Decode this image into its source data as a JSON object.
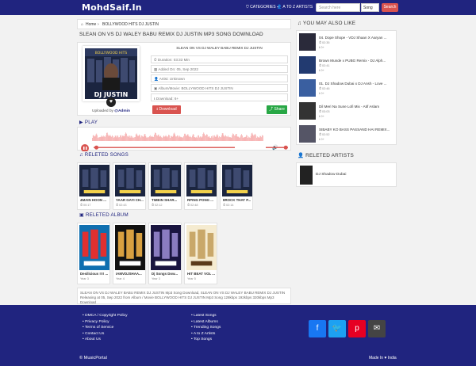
{
  "header": {
    "brand": "MohdSaif.In",
    "categories_label": "CATEGORIES",
    "artists_label": "A TO Z ARTISTS",
    "search_placeholder": "Search here",
    "search_scope": "Song",
    "search_button": "Search"
  },
  "breadcrumb": {
    "home": "Home",
    "sep": "›",
    "current": "BOLLYWOOD HITS DJ JUSTIN"
  },
  "song": {
    "page_title": "SLEAN ON VS DJ WALEY BABU REMIX DJ JUSTIN MP3 SONG DOWNLOAD",
    "info_title": "SLEAN ON VS DJ WALEY BABU REMIX DJ JUSTIN",
    "duration": "Duration: 03:33 Min",
    "added": "Added On: 05, Sep 2022",
    "artist": "Artist: Unknown",
    "album": "Album/Movie: BOLLYWOOD HITS DJ JUSTIN",
    "downloads": "Download: 6+",
    "uploaded_prefix": "Uploaded by",
    "uploaded_by": "@Admin",
    "download_label": "Download",
    "share_label": "Share",
    "cover_label": "DJ JUSTIN",
    "cover_top": "BOLLYWOOD HITS"
  },
  "sections": {
    "play": "PLAY",
    "related_songs": "RELETED SONGS",
    "related_album": "RELETED ALBUM",
    "you_may_like": "YOU MAY ALSO LIKE",
    "related_artists": "RELETED ARTISTS"
  },
  "player": {
    "progress": 0.02,
    "volume": 0.9,
    "accent": "#d9534f",
    "wave_color": "#f5a3a3"
  },
  "related_songs": [
    {
      "title": "4MAIN HOON ...",
      "meta": "00:17"
    },
    {
      "title": "YAAR GAYI CH...",
      "meta": "02:43"
    },
    {
      "title": "TIMEIN SHAR...",
      "meta": "02:12"
    },
    {
      "title": "RPING PONG ...",
      "meta": "02:48"
    },
    {
      "title": "8ROCK THAT P...",
      "meta": "02:14"
    }
  ],
  "related_albums": [
    {
      "title": "Desilicious !!!! ...",
      "meta": "Year 3"
    },
    {
      "title": "IAMVDJSHAA...",
      "meta": "Year 4"
    },
    {
      "title": "Dj Songs Dow...",
      "meta": "Year 3"
    },
    {
      "title": "HIT BEAT VOL ...",
      "meta": "Year 5"
    }
  ],
  "description": "SLEAN ON VS DJ WALEY BABU REMIX DJ JUSTIN Mp3 Song Download, SLEAN ON VS DJ WALEY BABU REMIX DJ JUSTIN Releasing at 05, Sep 2022 from Album / Movie BOLLYWOOD HITS DJ JUSTIN Mp3 Song 128kbps 192kbps 320kbps Mp3 Download",
  "you_may_like": [
    {
      "title": "04. Dope Shope - VDJ Shaan X Aaryan ...",
      "time": "02:35",
      "plays": "0+"
    },
    {
      "title": "Brown Munde x PUBG Remix - DJ Alph...",
      "time": "02:41",
      "plays": "0+"
    },
    {
      "title": "01. DJ Shadow Dubai x DJ Ansh - Love ...",
      "time": "02:46",
      "plays": "0+"
    },
    {
      "title": "Dil Meri Na Sune Lofi Mix - Atif Aslam",
      "time": "03:03",
      "plays": "0+"
    },
    {
      "title": "SIBABY KO BASS PASSAND HAI REMIX...",
      "time": "02:52",
      "plays": "0+"
    }
  ],
  "related_artists": [
    {
      "name": "DJ Shadow Dubai"
    }
  ],
  "footer": {
    "links": [
      "DMCA / Copyright Policy",
      "Privacy Policy",
      "Terms of Service",
      "Contact Us",
      "About Us"
    ],
    "links2": [
      "Latest Songs",
      "Latest Albums",
      "Trending Songs",
      "A to Z Artists",
      "Top Songs"
    ],
    "copyright": "© MusicPortal",
    "made_in_prefix": "Made In",
    "made_in_suffix": "India",
    "social": [
      {
        "icon": "facebook-icon",
        "glyph": "f",
        "color": "#1877f2"
      },
      {
        "icon": "twitter-icon",
        "glyph": "🐦",
        "color": "#1da1f2"
      },
      {
        "icon": "pinterest-icon",
        "glyph": "p",
        "color": "#e60023"
      },
      {
        "icon": "email-icon",
        "glyph": "✉",
        "color": "#444444"
      }
    ]
  }
}
